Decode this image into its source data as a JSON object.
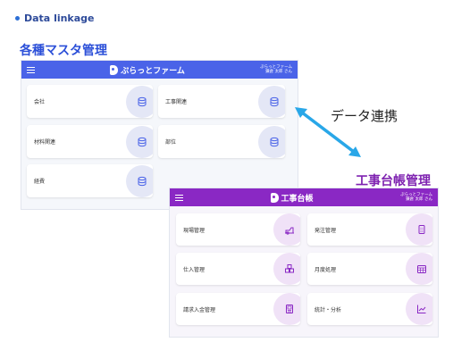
{
  "heading": "Data linkage",
  "master": {
    "title": "各種マスタ管理",
    "app_name": "ぷらっとファーム",
    "user_line1": "ぷらっとファーム",
    "user_line2": "鎌倉 太郎 さん",
    "cards": [
      "会社",
      "工事関連",
      "材料関連",
      "部位",
      "経費"
    ],
    "icon": "database-icon",
    "accent": "#4a63e8"
  },
  "link_label": "データ連携",
  "koji": {
    "title": "工事台帳管理",
    "app_name": "工事台帳",
    "user_line1": "ぷらっとファーム",
    "user_line2": "鎌倉 太郎 さん",
    "cards": [
      "現場管理",
      "発注管理",
      "仕入管理",
      "月度処理",
      "請求入金管理",
      "統計・分析"
    ],
    "icons": [
      "construction-icon",
      "calculator-icon",
      "boxes-icon",
      "calendar-icon",
      "invoice-icon",
      "chart-line-icon"
    ],
    "accent": "#8a28c4"
  }
}
